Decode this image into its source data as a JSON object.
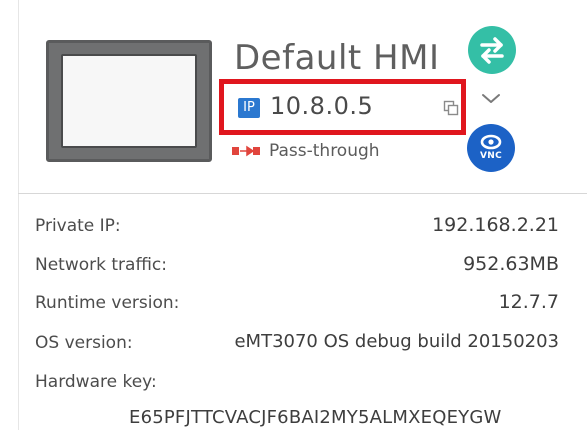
{
  "device": {
    "name": "Default HMI",
    "ip_badge": "IP",
    "ip_address": "10.8.0.5",
    "connection_mode": "Pass-through"
  },
  "buttons": {
    "vnc_label": "VNC"
  },
  "icons": {
    "device": "hmi-device-icon",
    "ip_badge": "ip-badge-icon",
    "copy": "copy-icon",
    "pass_through": "pass-through-icon",
    "transfer": "transfer-arrows-icon",
    "expand": "chevron-down-icon",
    "vnc": "vnc-eye-icon"
  },
  "colors": {
    "highlight_border": "#e0161e",
    "ip_badge": "#2b78d0",
    "transfer_button": "#34bfa6",
    "vnc_button": "#1c62c6",
    "pass_through_icon": "#e1453d"
  },
  "info": {
    "private_ip_label": "Private IP:",
    "private_ip_value": "192.168.2.21",
    "network_traffic_label": "Network traffic:",
    "network_traffic_value": "952.63MB",
    "runtime_version_label": "Runtime version:",
    "runtime_version_value": "12.7.7",
    "os_version_label": "OS version:",
    "os_version_value": "eMT3070 OS debug build 20150203",
    "hardware_key_label": "Hardware key:",
    "hardware_key_value": "E65PFJTTCVACJF6BAI2MY5ALMXEQEYGW"
  }
}
